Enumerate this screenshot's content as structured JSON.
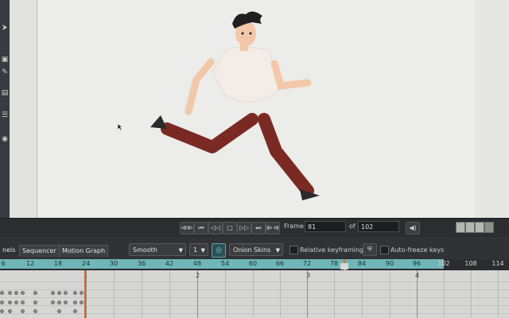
{
  "toolbar_left": {
    "icons": [
      "cursor-icon",
      "transform-icon",
      "pencil-icon",
      "bone-icon",
      "paint-icon",
      "pen-icon",
      "eye-icon"
    ]
  },
  "transport": {
    "frame_label": "Frame",
    "frame_value": "81",
    "of_label": "of",
    "total_frames": "102",
    "buttons": [
      "rewind",
      "step-back-key",
      "step-back",
      "stop",
      "play",
      "step-forward-key",
      "fast-forward"
    ]
  },
  "panel": {
    "tabs": [
      "nels",
      "Sequencer",
      "Motion Graph"
    ],
    "interpolation": "Smooth",
    "interp_value": "1",
    "onion_skins_label": "Onion Skins",
    "relative_keyframing_label": "Relative keyframing",
    "auto_freeze_label": "Auto-freeze keys"
  },
  "ruler": {
    "ticks": [
      "6",
      "12",
      "18",
      "24",
      "30",
      "36",
      "42",
      "48",
      "54",
      "60",
      "66",
      "72",
      "78",
      "84",
      "90",
      "96",
      "102",
      "108",
      "114"
    ],
    "current_frame": "81"
  },
  "grid": {
    "section_numbers": [
      "1",
      "2",
      "3",
      "4"
    ]
  },
  "colors": {
    "ruler_accent": "#6fb6b8",
    "playhead": "#e07a2e",
    "canvas_bg": "#ececea"
  }
}
